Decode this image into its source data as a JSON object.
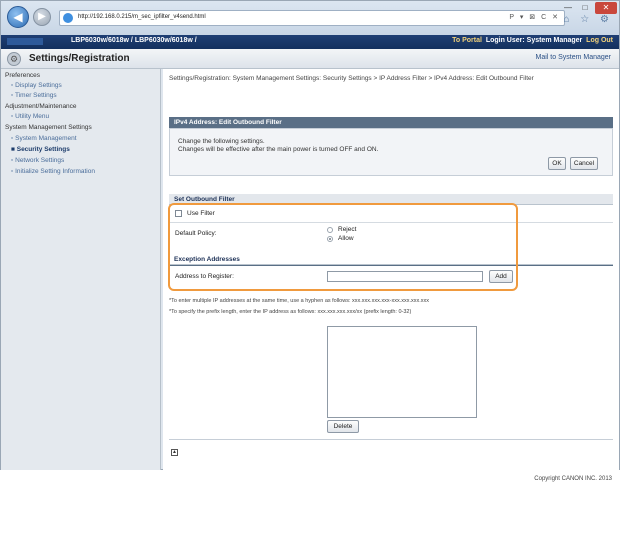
{
  "browser": {
    "url": "http://192.168.0.215/m_sec_ipfilter_v4send.html",
    "tools": "P ▾ ⊠ C ✕",
    "window_controls": {
      "minimize": "—",
      "maximize": "□",
      "close": "✕"
    },
    "toolbar_icons": "⌂ ☆ ⚙"
  },
  "device": {
    "model": "LBP6030w/6018w / LBP6030w/6018w /",
    "portal_link": "To Portal",
    "login_label": "Login User: System Manager",
    "logout_link": "Log Out"
  },
  "header": {
    "title": "Settings/Registration",
    "mail_link": "Mail to System Manager"
  },
  "sidebar": {
    "items": [
      {
        "label": "Preferences"
      },
      {
        "label": "Display Settings"
      },
      {
        "label": "Timer Settings"
      },
      {
        "label": "Adjustment/Maintenance"
      },
      {
        "label": "Utility Menu"
      },
      {
        "label": "System Management Settings"
      },
      {
        "label": "System Management"
      },
      {
        "label": "Security Settings"
      },
      {
        "label": "Network Settings"
      },
      {
        "label": "Initialize Setting Information"
      }
    ]
  },
  "main": {
    "breadcrumb": "Settings/Registration: System Management Settings: Security Settings > IP Address Filter > IPv4 Address: Edit Outbound Filter",
    "panel_title": "IPv4 Address: Edit Outbound Filter",
    "message_line1": "Change the following settings.",
    "message_line2": "Changes will be effective after the main power is turned OFF and ON.",
    "ok_label": "OK",
    "cancel_label": "Cancel",
    "section_outbound": "Set Outbound Filter",
    "use_filter_label": "Use Filter",
    "default_policy_label": "Default Policy:",
    "reject_label": "Reject",
    "allow_label": "Allow",
    "section_exceptions": "Exception Addresses",
    "address_label": "Address to Register:",
    "address_value": "",
    "add_label": "Add",
    "note1": "*To enter multiple IP addresses at the same time, use a hyphen as follows: xxx.xxx.xxx.xxx-xxx.xxx.xxx.xxx",
    "note2": "*To specify the prefix length, enter the IP address as follows: xxx.xxx.xxx.xxx/xx (prefix length: 0-32)",
    "delete_label": "Delete",
    "top_icon": "▲"
  },
  "footer": {
    "copyright": "Copyright CANON INC. 2013"
  },
  "colors": {
    "accent": "#f09a3e",
    "device_header": "#1f3f74",
    "panel_head": "#5a6f86"
  }
}
